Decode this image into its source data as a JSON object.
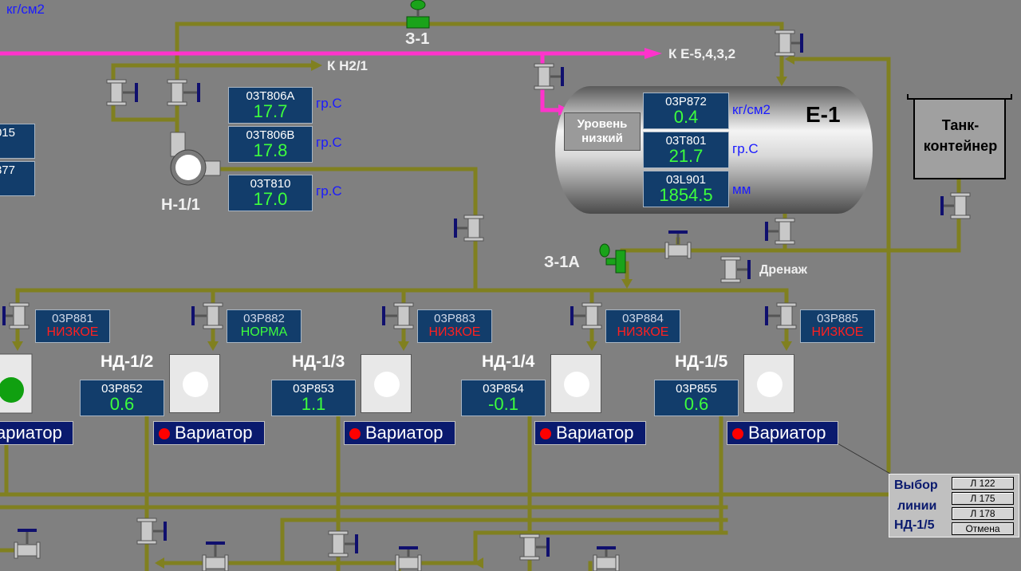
{
  "colors": {
    "pipe": "#808020",
    "magenta_pipe": "#ff33cc",
    "value_green": "#3dff3d",
    "alarm_red": "#ff2020",
    "unit_blue": "#1a1aff"
  },
  "top_unit": "кг/см2",
  "valve_labels": {
    "z1": "З-1",
    "z1a": "З-1А"
  },
  "arrows": {
    "h2": "К Н2/1",
    "e5": "К Е-5,4,3,2",
    "drain": "Дренаж"
  },
  "pump_main": "Н-1/1",
  "left_readouts": {
    "a": "015",
    "b": "377"
  },
  "temps": [
    {
      "tag": "03T806A",
      "value": "17.7",
      "unit": "гр.С"
    },
    {
      "tag": "03T806B",
      "value": "17.8",
      "unit": "гр.С"
    },
    {
      "tag": "03T810",
      "value": "17.0",
      "unit": "гр.С"
    }
  ],
  "tank": {
    "name": "Е-1",
    "level_status": "Уровень низкий",
    "readings": [
      {
        "tag": "03P872",
        "value": "0.4",
        "unit": "кг/см2"
      },
      {
        "tag": "03T801",
        "value": "21.7",
        "unit": "гр.С"
      },
      {
        "tag": "03L901",
        "value": "1854.5",
        "unit": "мм"
      }
    ]
  },
  "container": "Танк-контейнер",
  "alarms": [
    {
      "tag": "03P881",
      "status": "НИЗКОЕ",
      "color": "#ff2020"
    },
    {
      "tag": "03P882",
      "status": "НОРМА",
      "color": "#3dff3d"
    },
    {
      "tag": "03P883",
      "status": "НИЗКОЕ",
      "color": "#ff2020"
    },
    {
      "tag": "03P884",
      "status": "НИЗКОЕ",
      "color": "#ff2020"
    },
    {
      "tag": "03P885",
      "status": "НИЗКОЕ",
      "color": "#ff2020"
    }
  ],
  "pumps": [
    {
      "name": "НД-1/2",
      "tag": "03P852",
      "value": "0.6"
    },
    {
      "name": "НД-1/3",
      "tag": "03P853",
      "value": "1.1"
    },
    {
      "name": "НД-1/4",
      "tag": "03P854",
      "value": "-0.1"
    },
    {
      "name": "НД-1/5",
      "tag": "03P855",
      "value": "0.6"
    }
  ],
  "variator": "Вариатор",
  "variator_partial": "ариатор",
  "line_select": {
    "title1": "Выбор",
    "title2": "линии",
    "title3": "НД-1/5",
    "buttons": [
      "Л 122",
      "Л 175",
      "Л 178",
      "Отмена"
    ]
  }
}
